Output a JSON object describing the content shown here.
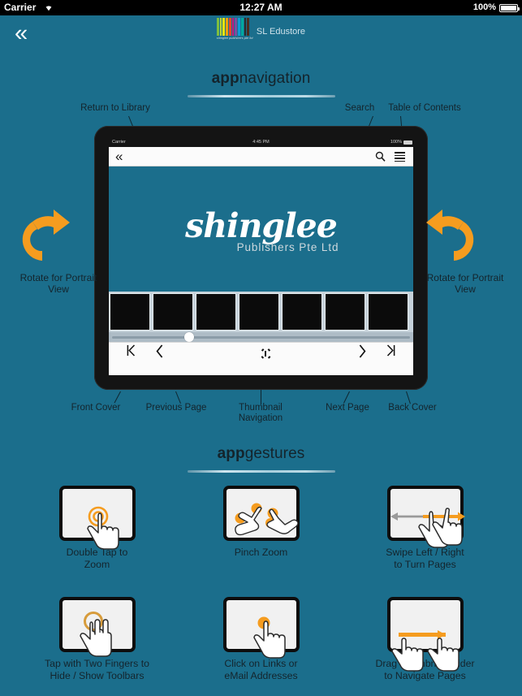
{
  "device_status_bar": {
    "carrier": "Carrier",
    "wifi_icon": "wifi-icon",
    "time": "12:27 AM",
    "battery_percent": "100%",
    "battery_icon": "battery-full-icon"
  },
  "app_bar": {
    "back_button_icon": "double-chevron-left-icon",
    "brand_name": "SL Edustore",
    "brand_logo_sub": "shinglee publishers pte ltd",
    "logo_bar_colors": [
      "#7fbf3f",
      "#bfd730",
      "#f5e400",
      "#f5a000",
      "#e8482c",
      "#c9177e",
      "#7b4ea0",
      "#0f9bd7",
      "#00a9a0",
      "#2a2a2a",
      "#4b2e1e"
    ]
  },
  "sections": {
    "navigation": {
      "bold": "app",
      "regular": "navigation"
    },
    "gestures": {
      "bold": "app",
      "regular": "gestures"
    }
  },
  "navigation_callouts": {
    "return_to_library": "Return to Library",
    "search": "Search",
    "table_of_contents": "Table of Contents",
    "front_cover": "Front Cover",
    "previous_page": "Previous Page",
    "thumbnail_navigation": "Thumbnail\nNavigation",
    "next_page": "Next Page",
    "back_cover": "Back Cover",
    "rotate_left": "Rotate for\nPortrait View",
    "rotate_right": "Rotate for\nPortrait View"
  },
  "ipad": {
    "status_bar": {
      "carrier": "Carrier",
      "time": "4:45 PM",
      "battery_percent": "100%"
    },
    "toolbar": {
      "back_icon": "double-chevron-left-icon",
      "search_icon": "search-icon",
      "toc_icon": "list-icon"
    },
    "page_content": {
      "logo_word": "shinglee",
      "logo_tagline": "Publishers Pte Ltd"
    },
    "thumbnail_navigation_label": "Thumbnail Navigation",
    "thumbnail_arrows": [
      "arrow-left-icon",
      "arrow-right-icon"
    ],
    "thumbnail_count": 7,
    "slider_position_percent": 25,
    "bottom_toolbar": {
      "first_page_icon": "skip-to-first-icon",
      "previous_page_icon": "chevron-left-icon",
      "thumbnail_nav_icon": "thumbnail-grid-icon",
      "next_page_icon": "chevron-right-icon",
      "last_page_icon": "skip-to-last-icon"
    }
  },
  "gestures": [
    {
      "label": "Double Tap to\nZoom",
      "icon": "one-finger-double-tap-icon"
    },
    {
      "label": "Pinch Zoom",
      "icon": "two-hand-pinch-icon"
    },
    {
      "label": "Swipe Left / Right\nto Turn Pages",
      "icon": "swipe-horizontal-icon"
    },
    {
      "label": "Tap with Two Fingers to\nHide / Show Toolbars",
      "icon": "two-finger-tap-icon"
    },
    {
      "label": "Click on Links or\neMail Addresses",
      "icon": "one-finger-tap-icon"
    },
    {
      "label": "Drag Thumbnial Slider\nto Navigate Pages",
      "icon": "drag-slider-icon"
    }
  ],
  "colors": {
    "background": "#1b6e8c",
    "accent_orange": "#f59c1f",
    "text_dark": "#14242c",
    "rule_light": "#cfe6ef"
  }
}
